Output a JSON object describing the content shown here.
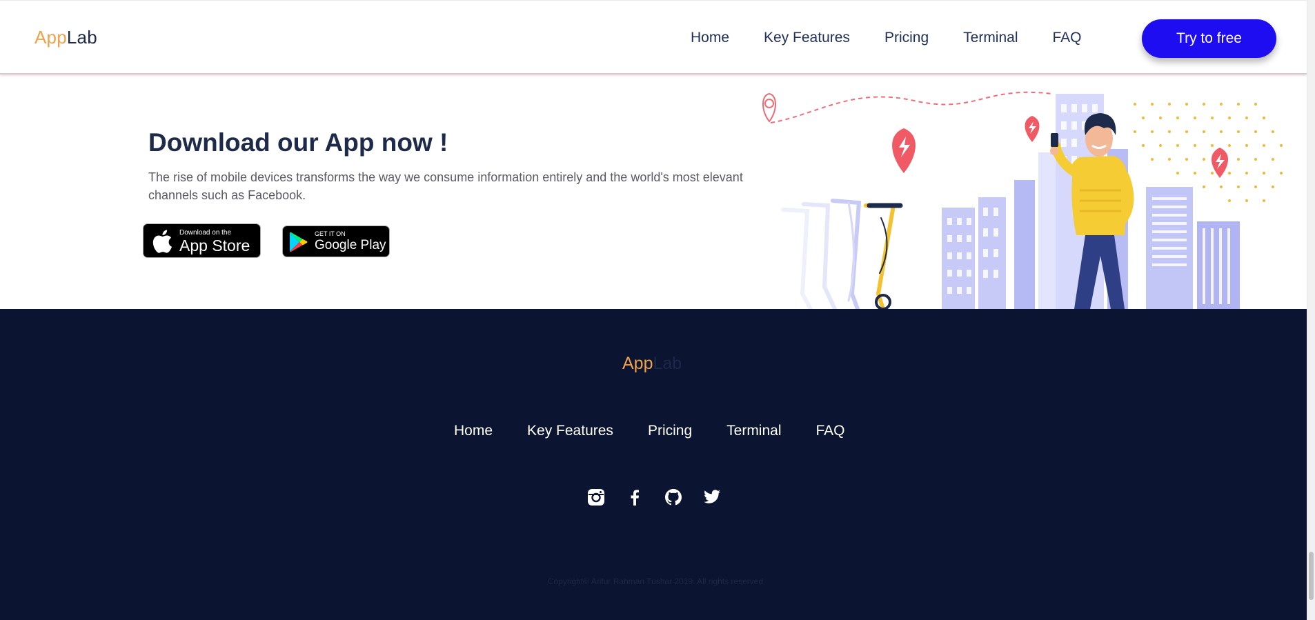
{
  "header": {
    "logo": {
      "part1": "App",
      "part2": "Lab"
    },
    "nav": [
      "Home",
      "Key Features",
      "Pricing",
      "Terminal",
      "FAQ"
    ],
    "cta_label": "Try to free"
  },
  "hero": {
    "title": "Download our App now !",
    "text": "The rise of mobile devices transforms the way we consume information entirely and the world's most elevant channels such as Facebook.",
    "app_store": {
      "small": "Download on the",
      "big": "App Store",
      "icon": "apple-icon"
    },
    "google_play": {
      "small": "GET IT ON",
      "big": "Google Play",
      "icon": "google-play-icon"
    }
  },
  "footer": {
    "logo": {
      "part1": "App",
      "part2": "Lab"
    },
    "nav": [
      "Home",
      "Key Features",
      "Pricing",
      "Terminal",
      "FAQ"
    ],
    "socials": [
      "instagram-icon",
      "facebook-icon",
      "github-icon",
      "twitter-icon"
    ],
    "copyright": "Copyright© Arifur Rahman Tushar 2019. All rights reserved"
  },
  "colors": {
    "accent": "#1f0df2",
    "logo_orange": "#f0a24b",
    "navy": "#1e2a4a",
    "footer_bg": "#0b1430"
  }
}
